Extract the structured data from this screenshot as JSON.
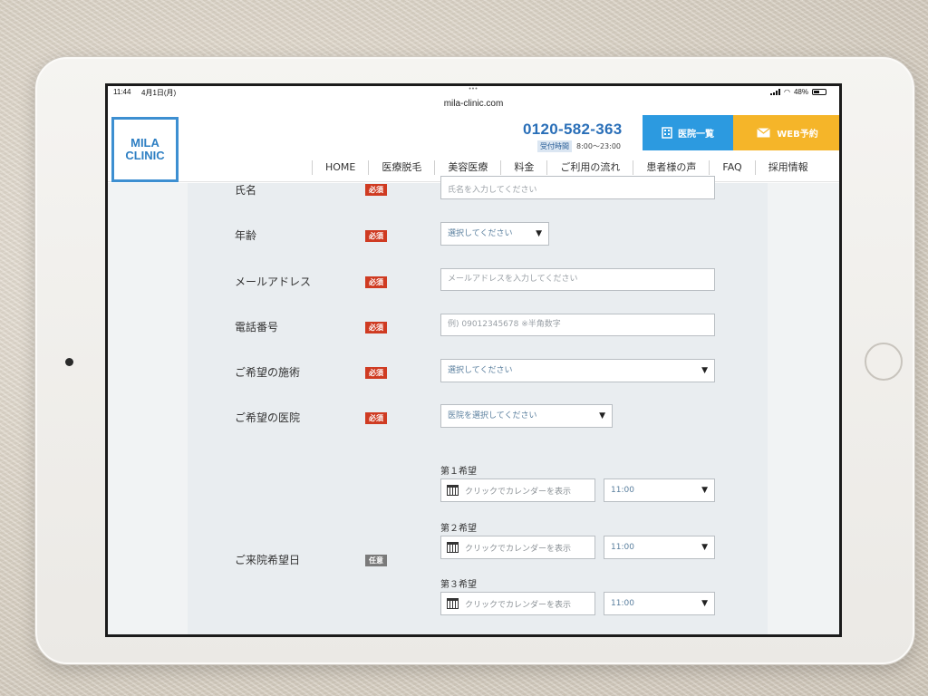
{
  "status_bar": {
    "time": "11:44",
    "date": "4月1日(月)",
    "battery": "48%",
    "dots": "•••"
  },
  "browser": {
    "url": "mila-clinic.com"
  },
  "header": {
    "logo_line1": "MILA",
    "logo_line2": "CLINIC",
    "phone": "0120-582-363",
    "hours_tag": "受付時間",
    "hours": "8:00〜23:00",
    "clinic_list_label": "医院一覧",
    "web_booking_label": "WEB予約"
  },
  "nav": {
    "items": [
      "HOME",
      "医療脱毛",
      "美容医療",
      "料金",
      "ご利用の流れ",
      "患者様の声",
      "FAQ",
      "採用情報"
    ]
  },
  "form": {
    "required_badge": "必須",
    "optional_badge": "任意",
    "name": {
      "label": "氏名",
      "placeholder": "氏名を入力してください"
    },
    "age": {
      "label": "年齢",
      "value": "選択してください"
    },
    "email": {
      "label": "メールアドレス",
      "placeholder": "メールアドレスを入力してください"
    },
    "phone": {
      "label": "電話番号",
      "placeholder": "例) 09012345678 ※半角数字"
    },
    "treatment": {
      "label": "ご希望の施術",
      "value": "選択してください"
    },
    "clinic": {
      "label": "ご希望の医院",
      "value": "医院を選択してください"
    },
    "visit": {
      "label": "ご来院希望日",
      "preferences": [
        {
          "label": "第１希望",
          "date_placeholder": "クリックでカレンダーを表示",
          "time": "11:00"
        },
        {
          "label": "第２希望",
          "date_placeholder": "クリックでカレンダーを表示",
          "time": "11:00"
        },
        {
          "label": "第３希望",
          "date_placeholder": "クリックでカレンダーを表示",
          "time": "11:00"
        }
      ]
    }
  },
  "colors": {
    "accent_blue": "#2c9ae0",
    "accent_yellow": "#f5b529",
    "required_red": "#cf3b22"
  }
}
